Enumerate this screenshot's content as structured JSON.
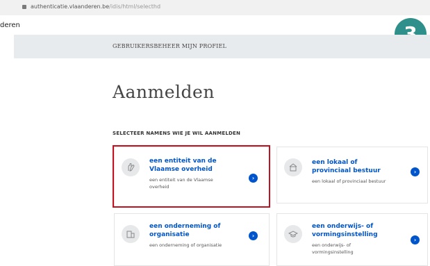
{
  "browser": {
    "url_host": "authenticatie.vlaanderen.be",
    "url_path": "/idis/html/selecthd"
  },
  "header": {
    "brand_fragment": "deren",
    "nav_label": "GEBRUIKERSBEHEER MIJN PROFIEL"
  },
  "step_badge": "3",
  "main": {
    "title": "Aanmelden",
    "section_label": "SELECTEER NAMENS WIE JE WIL AANMELDEN",
    "options": [
      {
        "title": "een entiteit van de Vlaamse overheid",
        "subtitle": "een entiteit van de Vlaamse overheid",
        "icon": "hand-icon",
        "highlighted": true
      },
      {
        "title": "een lokaal of provinciaal bestuur",
        "subtitle": "een lokaal of provinciaal bestuur",
        "icon": "building-icon",
        "highlighted": false
      },
      {
        "title": "een onderneming of organisatie",
        "subtitle": "een onderneming of organisatie",
        "icon": "office-icon",
        "highlighted": false
      },
      {
        "title": "een onderwijs- of vormingsinstelling",
        "subtitle": "een onderwijs- of vormingsinstelling",
        "icon": "graduation-cap-icon",
        "highlighted": false
      }
    ]
  },
  "colors": {
    "accent_blue": "#0055cc",
    "badge_teal": "#2f8f8a",
    "highlight_red": "#c1121f"
  }
}
